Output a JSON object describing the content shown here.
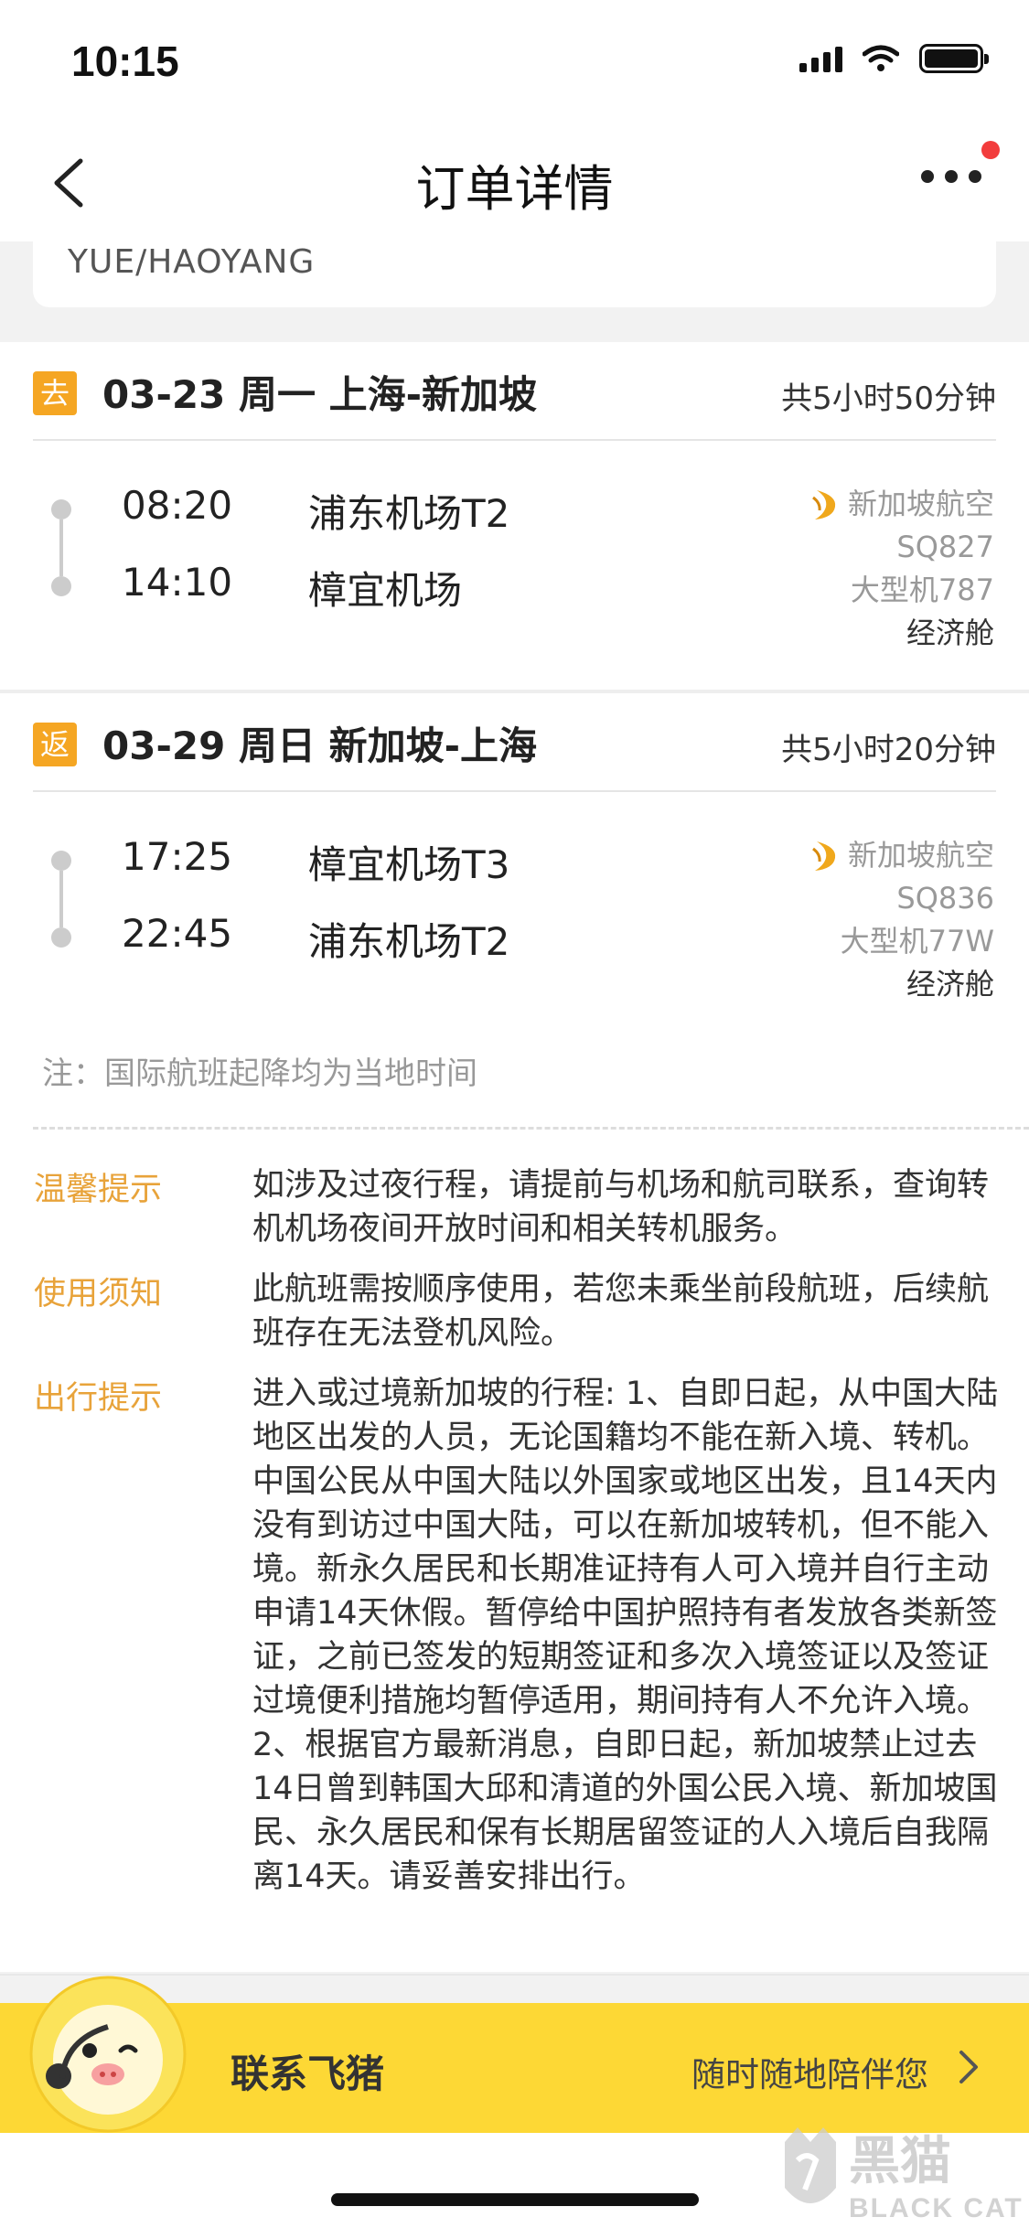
{
  "status_bar": {
    "time": "10:15"
  },
  "nav": {
    "title": "订单详情"
  },
  "passenger": {
    "name": "YUE/HAOYANG"
  },
  "legs": [
    {
      "tag": "去",
      "route": "03-23 周一 上海-新加坡",
      "duration": "共5小时50分钟",
      "depart_time": "08:20",
      "depart_airport": "浦东机场T2",
      "arrive_time": "14:10",
      "arrive_airport": "樟宜机场",
      "airline": "新加坡航空",
      "flight_no": "SQ827",
      "aircraft": "大型机787",
      "cabin": "经济舱"
    },
    {
      "tag": "返",
      "route": "03-29 周日 新加坡-上海",
      "duration": "共5小时20分钟",
      "depart_time": "17:25",
      "depart_airport": "樟宜机场T3",
      "arrive_time": "22:45",
      "arrive_airport": "浦东机场T2",
      "airline": "新加坡航空",
      "flight_no": "SQ836",
      "aircraft": "大型机77W",
      "cabin": "经济舱"
    }
  ],
  "note": "注：国际航班起降均为当地时间",
  "tips": [
    {
      "label": "温馨提示",
      "text": "如涉及过夜行程，请提前与机场和航司联系，查询转机机场夜间开放时间和相关转机服务。"
    },
    {
      "label": "使用须知",
      "text": "此航班需按顺序使用，若您未乘坐前段航班，后续航班存在无法登机风险。"
    },
    {
      "label": "出行提示",
      "text": "进入或过境新加坡的行程: 1、自即日起，从中国大陆地区出发的人员，无论国籍均不能在新入境、转机。中国公民从中国大陆以外国家或地区出发，且14天内没有到访过中国大陆，可以在新加坡转机，但不能入境。新永久居民和长期准证持有人可入境并自行主动申请14天休假。暂停给中国护照持有者发放各类新签证，之前已签发的短期签证和多次入境签证以及签证过境便利措施均暂停适用，期间持有人不允许入境。2、根据官方最新消息，自即日起，新加坡禁止过去14日曾到韩国大邱和清道的外国公民入境、新加坡国民、永久居民和保有长期居留签证的人入境后自我隔离14天。请妥善安排出行。"
    }
  ],
  "contact": {
    "label": "联系飞猪",
    "sub": "随时随地陪伴您"
  },
  "watermark": {
    "text_cn": "黑猫",
    "text_en": "BLACK CAT"
  },
  "colors": {
    "accent": "#f5a623",
    "tip_label": "#e8a33a",
    "banner": "#fdd835"
  }
}
